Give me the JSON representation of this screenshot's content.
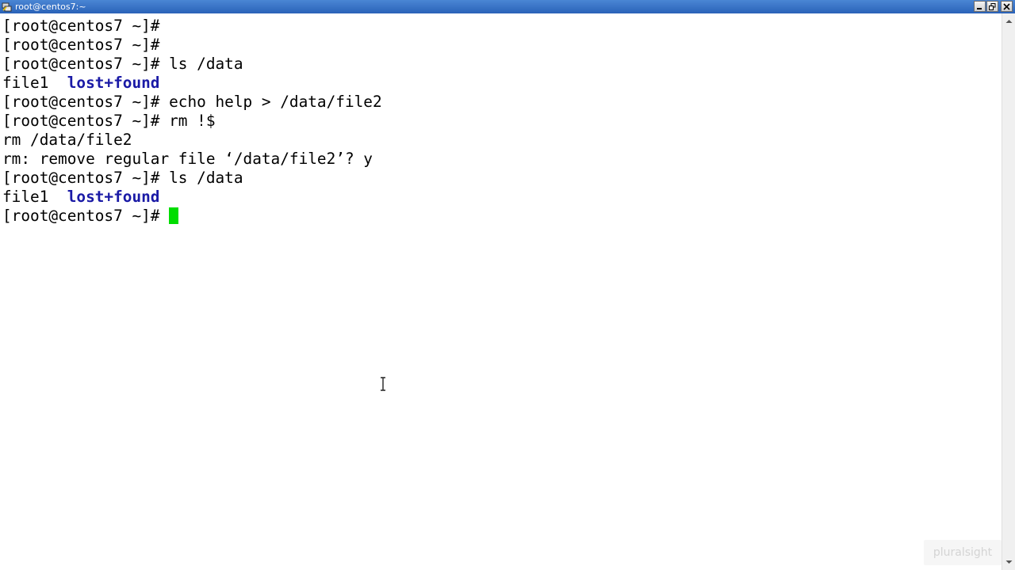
{
  "window": {
    "title": "root@centos7:~",
    "controls": {
      "minimize_icon": "minimize-icon",
      "maximize_icon": "restore-icon",
      "close_icon": "close-icon"
    }
  },
  "terminal": {
    "colors": {
      "background": "#ffffff",
      "text": "#000000",
      "directory": "#1a1aa6",
      "cursor": "#00dd00"
    },
    "lines": [
      {
        "text": "[root@centos7 ~]#"
      },
      {
        "text": "[root@centos7 ~]#"
      },
      {
        "text": "[root@centos7 ~]# ls /data"
      },
      {
        "file": "file1",
        "sep": "  ",
        "dir": "lost+found"
      },
      {
        "text": "[root@centos7 ~]# echo help > /data/file2"
      },
      {
        "text": "[root@centos7 ~]# rm !$"
      },
      {
        "text": "rm /data/file2"
      },
      {
        "text": "rm: remove regular file ‘/data/file2’? y"
      },
      {
        "text": "[root@centos7 ~]# ls /data"
      },
      {
        "file": "file1",
        "sep": "  ",
        "dir": "lost+found"
      },
      {
        "text": "[root@centos7 ~]# "
      }
    ]
  },
  "watermark": {
    "text": "pluralsight"
  }
}
